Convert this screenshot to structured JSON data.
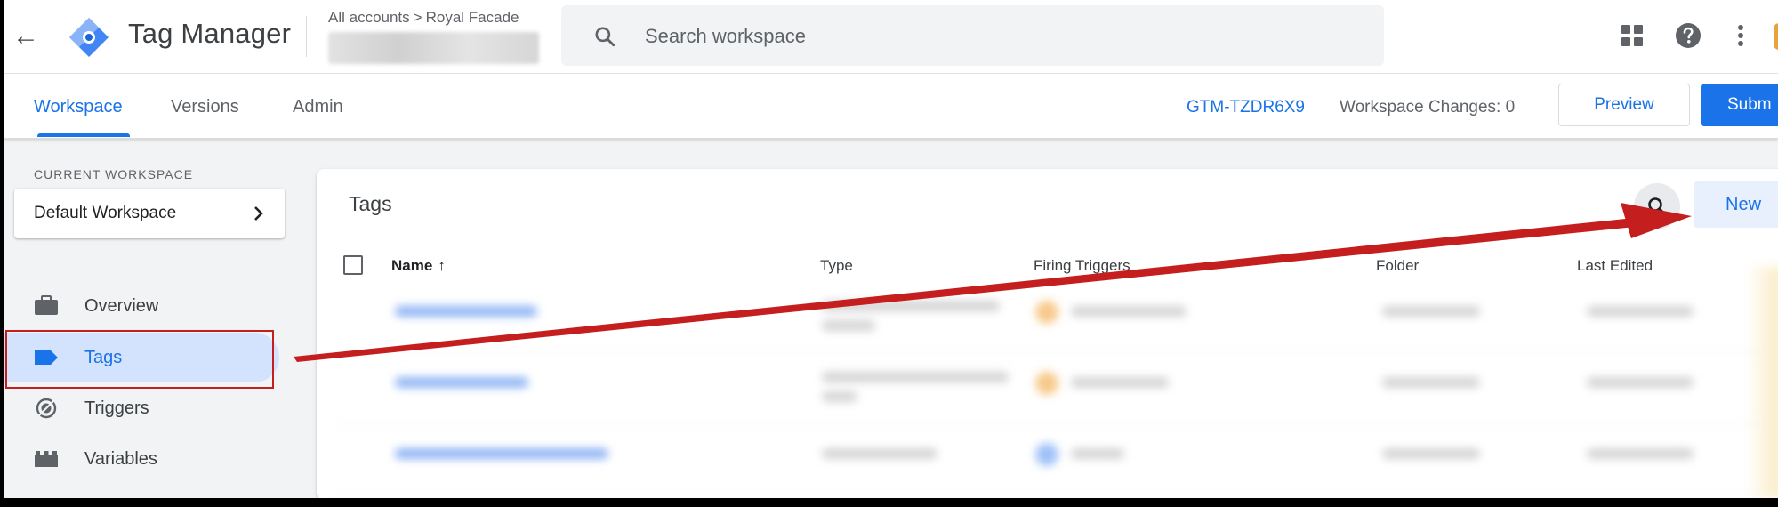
{
  "header": {
    "back_glyph": "←",
    "app_title": "Tag Manager",
    "breadcrumb": {
      "part1": "All accounts",
      "separator": ">",
      "part2": "Royal Facade"
    },
    "search_placeholder": "Search workspace"
  },
  "nav": {
    "tabs": [
      {
        "label": "Workspace",
        "active": true
      },
      {
        "label": "Versions",
        "active": false
      },
      {
        "label": "Admin",
        "active": false
      }
    ],
    "container_id": "GTM-TZDR6X9",
    "workspace_changes": "Workspace Changes: 0",
    "preview_label": "Preview",
    "submit_label": "Subm"
  },
  "sidebar": {
    "current_workspace_label": "CURRENT WORKSPACE",
    "workspace_name": "Default Workspace",
    "items": [
      {
        "label": "Overview",
        "icon": "briefcase-icon",
        "active": false
      },
      {
        "label": "Tags",
        "icon": "tag-icon",
        "active": true
      },
      {
        "label": "Triggers",
        "icon": "trigger-icon",
        "active": false
      },
      {
        "label": "Variables",
        "icon": "variables-icon",
        "active": false
      }
    ]
  },
  "tags_panel": {
    "title": "Tags",
    "new_label": "New",
    "columns": [
      "Name",
      "Type",
      "Firing Triggers",
      "Folder",
      "Last Edited"
    ],
    "sort_glyph": "↑"
  },
  "colors": {
    "accent": "#1a73e8",
    "annotation": "#c41e1e",
    "active_nav_bg": "#d3e3fd"
  }
}
